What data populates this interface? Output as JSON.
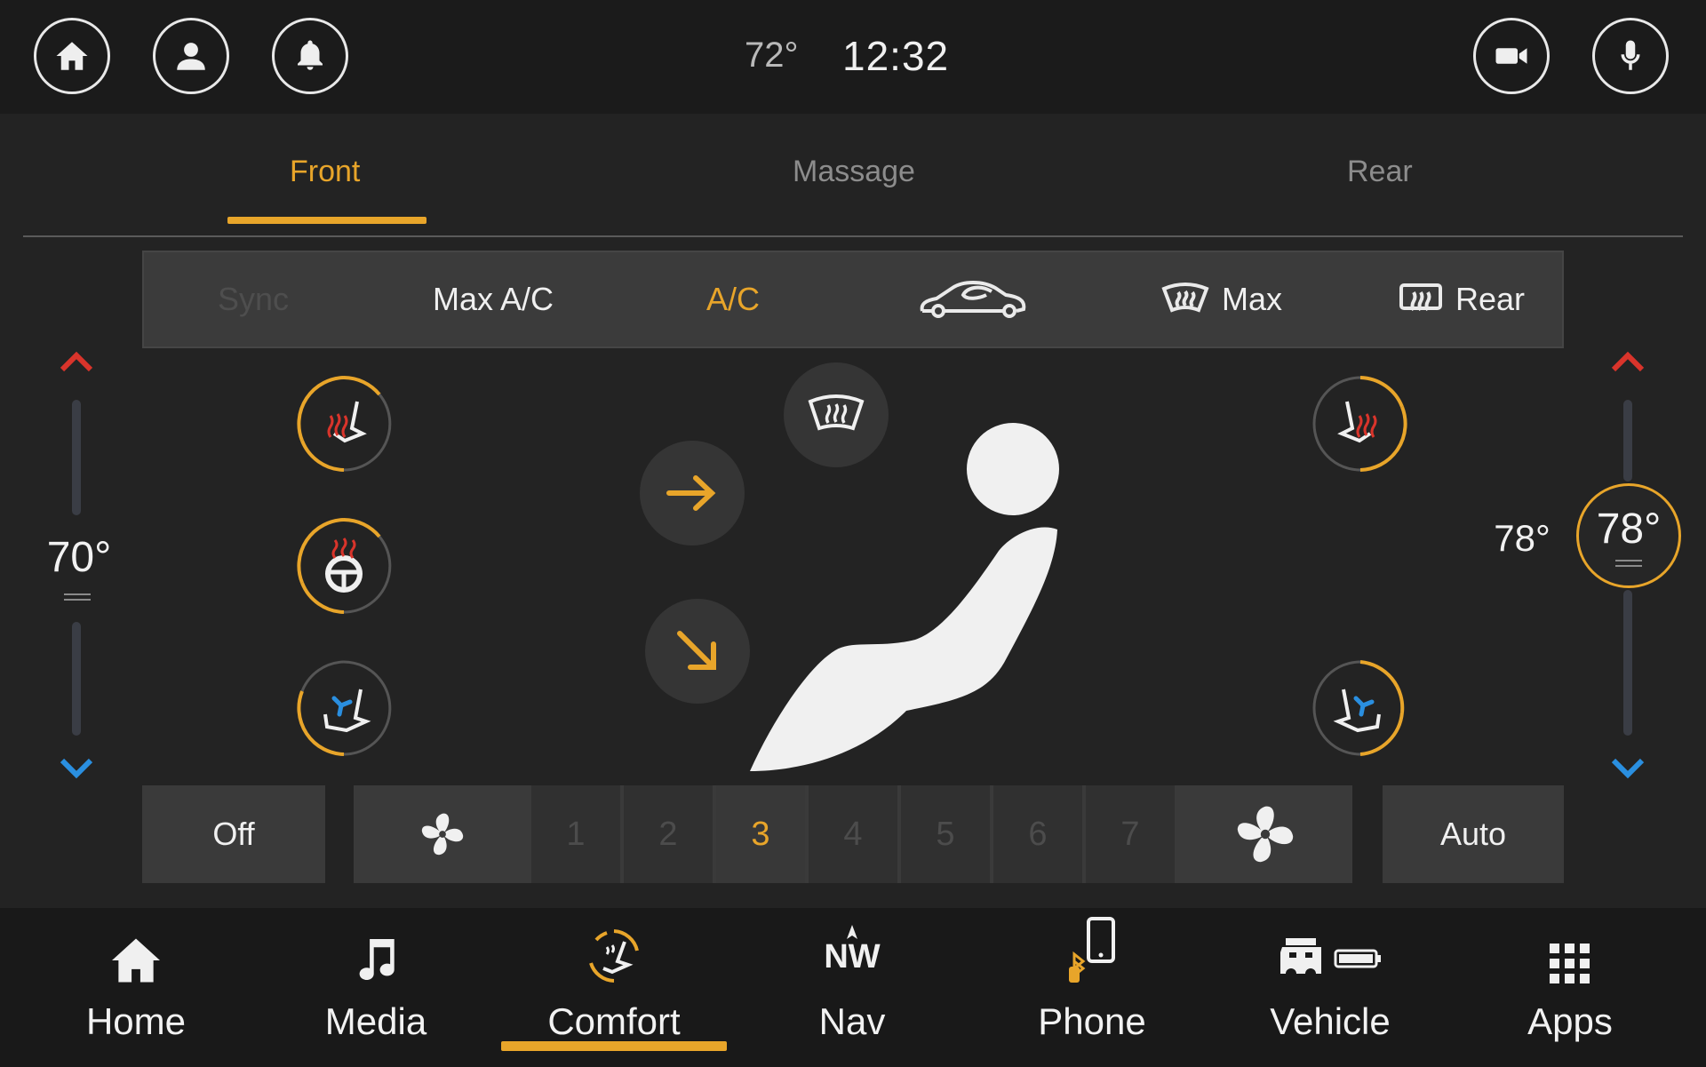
{
  "topbar": {
    "outside_temp": "72°",
    "clock": "12:32",
    "left_buttons": [
      "home-icon",
      "user-icon",
      "bell-icon"
    ],
    "right_buttons": [
      "video-camera-icon",
      "microphone-icon"
    ]
  },
  "tabs": [
    {
      "label": "Front",
      "active": true
    },
    {
      "label": "Massage",
      "active": false
    },
    {
      "label": "Rear",
      "active": false
    }
  ],
  "controls": {
    "sync": "Sync",
    "max_ac": "Max A/C",
    "ac": "A/C",
    "recirc_icon": "car-recirculation-icon",
    "max_defrost": "Max",
    "rear_defrost": "Rear"
  },
  "driver": {
    "temp": "70°"
  },
  "passenger": {
    "temp_small": "78°",
    "temp": "78°"
  },
  "fan": {
    "off": "Off",
    "auto": "Auto",
    "speeds": [
      "1",
      "2",
      "3",
      "4",
      "5",
      "6",
      "7"
    ],
    "active_speed": "3"
  },
  "nav": [
    {
      "label": "Home",
      "icon": "home-icon"
    },
    {
      "label": "Media",
      "icon": "music-note-icon"
    },
    {
      "label": "Comfort",
      "icon": "comfort-icon",
      "active": true
    },
    {
      "label": "Nav",
      "icon": "compass-icon",
      "compass_text": "NW"
    },
    {
      "label": "Phone",
      "icon": "phone-icon"
    },
    {
      "label": "Vehicle",
      "icon": "jeep-icon"
    },
    {
      "label": "Apps",
      "icon": "apps-grid-icon"
    }
  ],
  "colors": {
    "accent": "#e8a52a",
    "heat": "#d9342b",
    "cool": "#2a8fe0"
  }
}
